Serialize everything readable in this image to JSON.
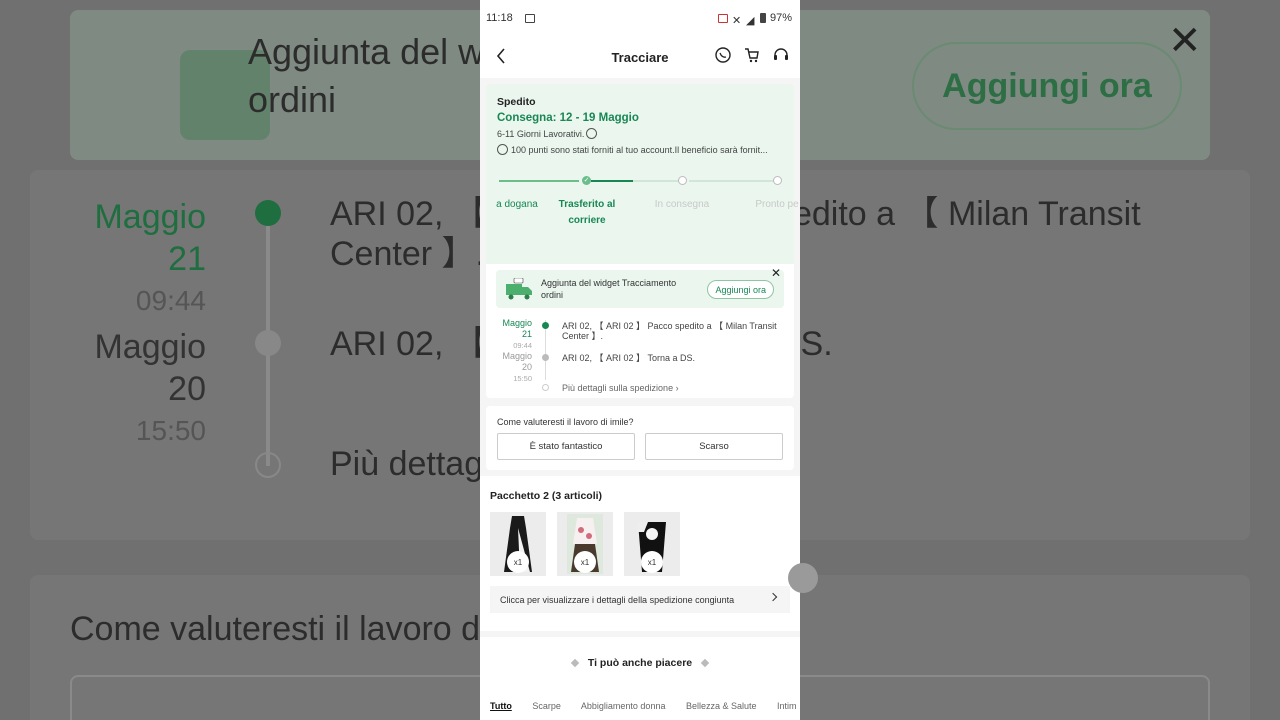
{
  "status_bar": {
    "time": "11:18",
    "battery": "97%"
  },
  "header": {
    "title": "Tracciare"
  },
  "shipment": {
    "status": "Spedito",
    "delivery": "Consegna: 12 - 19 Maggio",
    "days": "6-11 Giorni Lavorativi.",
    "points_note": "100 punti sono stati forniti al tuo account.Il beneficio sarà fornit..."
  },
  "progress": {
    "steps": [
      {
        "label": "a dogana",
        "state": "done"
      },
      {
        "label": "Trasferito al corriere",
        "state": "current"
      },
      {
        "label": "In consegna",
        "state": "pending"
      },
      {
        "label": "Pronto pe",
        "state": "pending"
      }
    ]
  },
  "widget": {
    "text": "Aggiunta del widget Tracciamento ordini",
    "button": "Aggiungi ora"
  },
  "timeline": [
    {
      "month": "Maggio",
      "day": "21",
      "time": "09:44",
      "event": "ARI 02, 【 ARI 02 】 Pacco spedito a 【 Milan Transit Center 】."
    },
    {
      "month": "Maggio",
      "day": "20",
      "time": "15:50",
      "event": "ARI 02, 【 ARI 02 】 Torna a DS."
    },
    {
      "event": "Più dettagli sulla spedizione"
    }
  ],
  "rating": {
    "question": "Come valuteresti il lavoro di imile?",
    "good": "È stato fantastico",
    "bad": "Scarso"
  },
  "package": {
    "title": "Pacchetto 2 (3 articoli)",
    "items": [
      {
        "qty": "x1"
      },
      {
        "qty": "x1"
      },
      {
        "qty": "x1"
      }
    ],
    "link": "Clicca per visualizzare i dettagli della spedizione congiunta"
  },
  "recommend": {
    "title": "Ti può anche piacere",
    "tabs": [
      "Tutto",
      "Scarpe",
      "Abbigliamento donna",
      "Bellezza & Salute",
      "Intim"
    ]
  },
  "colors": {
    "accent": "#198754",
    "mint": "#eaf6ee"
  }
}
